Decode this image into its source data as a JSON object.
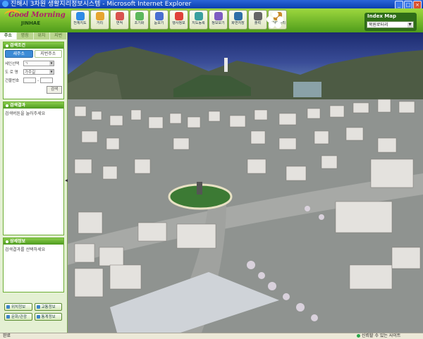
{
  "window": {
    "title": "진해시 3차원 생활지리정보시스템 - Microsoft Internet Explorer"
  },
  "logo": {
    "line1": "Good Morning",
    "line2": "JINHAE"
  },
  "toolbar": [
    {
      "label": "전체지도",
      "icon": "globe-icon",
      "color": "#2f8be6"
    },
    {
      "label": "거리",
      "icon": "ruler-icon",
      "color": "#e6a52f"
    },
    {
      "label": "면적",
      "icon": "area-icon",
      "color": "#d9534f"
    },
    {
      "label": "초기화",
      "icon": "refresh-icon",
      "color": "#5cb85c"
    },
    {
      "label": "돋보기",
      "icon": "magnifier-icon",
      "color": "#4a6fd1"
    },
    {
      "label": "행사정보",
      "icon": "pin-icon",
      "color": "#e0413a"
    },
    {
      "label": "지도동록",
      "icon": "map-icon",
      "color": "#3aa0a0"
    },
    {
      "label": "정보보기",
      "icon": "info-icon",
      "color": "#7e5cc2"
    },
    {
      "label": "화면저장",
      "icon": "save-icon",
      "color": "#2e6fa8"
    },
    {
      "label": "출력",
      "icon": "print-icon",
      "color": "#666666"
    },
    {
      "label": "데이터관리",
      "icon": "data-icon",
      "color": "#c98b2a"
    }
  ],
  "index_map": {
    "title": "Index Map",
    "selected": "북원로터리"
  },
  "left": {
    "tabs": [
      "주소",
      "명칭",
      "위치",
      "지번"
    ],
    "search_condition": {
      "title": "검색조건",
      "subtabs": [
        "새주소",
        "지번주소"
      ],
      "fields": [
        {
          "label": "세인선택",
          "value": "ㄱ"
        },
        {
          "label": "도 로 명",
          "value": "가주길"
        },
        {
          "label": "건물번호",
          "value": "-"
        }
      ],
      "search_button": "검색"
    },
    "search_result": {
      "title": "검색결과",
      "message": "검색버튼을 눌러주세요"
    },
    "detail": {
      "title": "상세정보",
      "message": "검색결과를 선택하세요"
    },
    "bottom_buttons": [
      "위치정보",
      "교통정보",
      "문화/관광",
      "통계정보"
    ]
  },
  "status": {
    "left": "완료",
    "right": "신뢰할 수 있는 사이트"
  },
  "colors": {
    "header_green": "#6cb82c",
    "panel_green": "#4d9a1f",
    "selected_tab": "#3c8bd6"
  }
}
